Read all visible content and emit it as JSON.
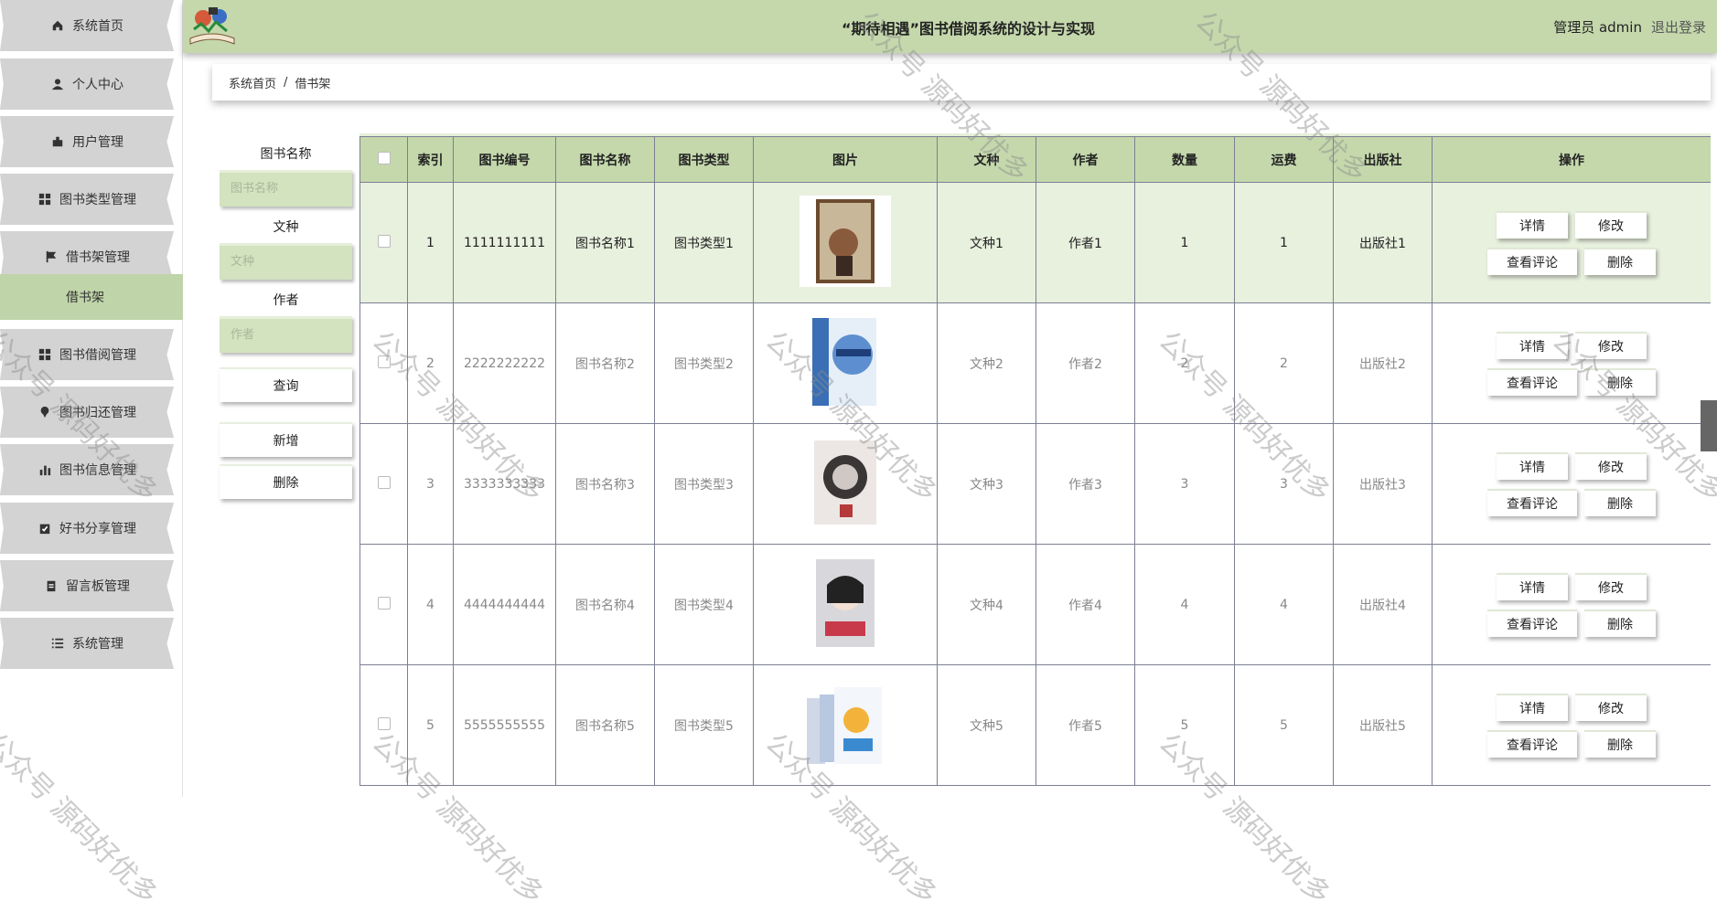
{
  "header": {
    "title": "“期待相遇”图书借阅系统的设计与实现",
    "user": "管理员 admin",
    "logout": "退出登录"
  },
  "sidebar": {
    "items": [
      {
        "label": "系统首页",
        "icon": "home-icon"
      },
      {
        "label": "个人中心",
        "icon": "user-icon"
      },
      {
        "label": "用户管理",
        "icon": "user-manage-icon"
      },
      {
        "label": "图书类型管理",
        "icon": "grid-icon"
      },
      {
        "label": "借书架管理",
        "icon": "flag-icon"
      },
      {
        "label": "借书架",
        "icon": ""
      },
      {
        "label": "图书借阅管理",
        "icon": "grid-icon"
      },
      {
        "label": "图书归还管理",
        "icon": "pin-icon"
      },
      {
        "label": "图书信息管理",
        "icon": "bar-chart-icon"
      },
      {
        "label": "好书分享管理",
        "icon": "clipboard-check-icon"
      },
      {
        "label": "留言板管理",
        "icon": "clipboard-icon"
      },
      {
        "label": "系统管理",
        "icon": "list-icon"
      }
    ]
  },
  "breadcrumb": {
    "home": "系统首页",
    "separator": "/",
    "current": "借书架"
  },
  "search": {
    "fields": [
      {
        "label": "图书名称",
        "placeholder": "图书名称"
      },
      {
        "label": "文种",
        "placeholder": "文种"
      },
      {
        "label": "作者",
        "placeholder": "作者"
      }
    ],
    "query_label": "查询",
    "add_label": "新增",
    "delete_label": "删除"
  },
  "table": {
    "headers": [
      "索引",
      "图书编号",
      "图书名称",
      "图书类型",
      "图片",
      "文种",
      "作者",
      "数量",
      "运费",
      "出版社",
      "操作"
    ],
    "rows": [
      {
        "index": "1",
        "code": "1111111111",
        "name": "图书名称1",
        "type": "图书类型1",
        "lang": "文种1",
        "author": "作者1",
        "qty": "1",
        "fee": "1",
        "publisher": "出版社1"
      },
      {
        "index": "2",
        "code": "2222222222",
        "name": "图书名称2",
        "type": "图书类型2",
        "lang": "文种2",
        "author": "作者2",
        "qty": "2",
        "fee": "2",
        "publisher": "出版社2"
      },
      {
        "index": "3",
        "code": "3333333333",
        "name": "图书名称3",
        "type": "图书类型3",
        "lang": "文种3",
        "author": "作者3",
        "qty": "3",
        "fee": "3",
        "publisher": "出版社3"
      },
      {
        "index": "4",
        "code": "4444444444",
        "name": "图书名称4",
        "type": "图书类型4",
        "lang": "文种4",
        "author": "作者4",
        "qty": "4",
        "fee": "4",
        "publisher": "出版社4"
      },
      {
        "index": "5",
        "code": "5555555555",
        "name": "图书名称5",
        "type": "图书类型5",
        "lang": "文种5",
        "author": "作者5",
        "qty": "5",
        "fee": "5",
        "publisher": "出版社5"
      }
    ],
    "actions": {
      "detail": "详情",
      "edit": "修改",
      "comments": "查看评论",
      "delete": "删除"
    }
  },
  "watermark": "公众号 源码好优多",
  "colors": {
    "header": "#c4d8ac",
    "sidebar_item": "#d3d3d3",
    "active": "#bfd4a8",
    "input": "#d3e2bf"
  }
}
